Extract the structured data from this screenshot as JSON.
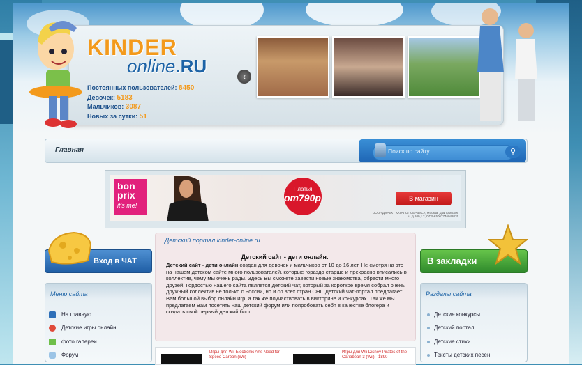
{
  "header": {
    "logo_main": "KINDER",
    "logo_sub": "online",
    "logo_tld": ".RU",
    "stats": [
      {
        "label": "Постоянных пользователей:",
        "value": "8450"
      },
      {
        "label": "Девочек:",
        "value": "5183"
      },
      {
        "label": "Мальчиков:",
        "value": "3087"
      },
      {
        "label": "Новых за сутки:",
        "value": "51"
      }
    ],
    "slider_prev": "‹",
    "slider_next": "›"
  },
  "nav": {
    "home": "Главная",
    "search_placeholder": "Поиск по сайту...",
    "search_icon": "search-icon"
  },
  "ad": {
    "brand": "bon prix",
    "brand_sub": "it's me!",
    "promo_line1": "Платья",
    "promo_line2": "от790р.",
    "cta": "В магазин",
    "fine_print": "ООО «ДИРЕКТ КАТАЛОГ СЕРВИС», Москва, Дмитровское ш.,д.100,к.2, ОГРН 5067746042035"
  },
  "left": {
    "chat_button": "Вход в ЧАТ",
    "menu_title": "Меню сайта",
    "menu_items": [
      "На главную",
      "Детские игры онлайн",
      "фото галереи",
      "Форум"
    ]
  },
  "right": {
    "bookmark_button": "В закладки",
    "sections_title": "Разделы сайта",
    "sections": [
      "Детские конкурсы",
      "Детский портал",
      "Детские стихи",
      "Тексты детских песен"
    ]
  },
  "content": {
    "link": "Детский портал kinder-online.ru",
    "title": "Детский сайт - дети онлайн.",
    "lead_bold": "Детский сайт - дети онлайн",
    "body": " создан для девочек и мальчиков от 10 до 16 лет. Не смотря на это на нашем детском сайте много пользователей, которые гораздо старше и прекрасно вписались в коллектив, чему мы очень рады. Здесь Вы сможете завести новые знакомства, обрести много друзей. Гордостью нашего сайта является детский чат, который за короткое время собрал очень дружный коллектив не только с России, но и со всех стран СНГ. Детский чат-портал предлагает Вам большой выбор онлайн игр, а так же поучаствовать в викторине и конкурсах. Так же мы предлагаем Вам посетить наш детский форум или попробовать себя в качестве блогера и создать свой первый детский блог."
  },
  "games": [
    {
      "text": "Игры для Wii Electronic Arts Need for Speed Carbon (Wii) -"
    },
    {
      "text": "Игры для Wii Disney Pirates of the Caribbean 3 (Wii) - 1890"
    }
  ],
  "colors": {
    "accent_orange": "#f39a1c",
    "link_blue": "#1d63a6",
    "chat_blue": "#1f5ea5",
    "bookmark_green": "#2f8a2c"
  }
}
